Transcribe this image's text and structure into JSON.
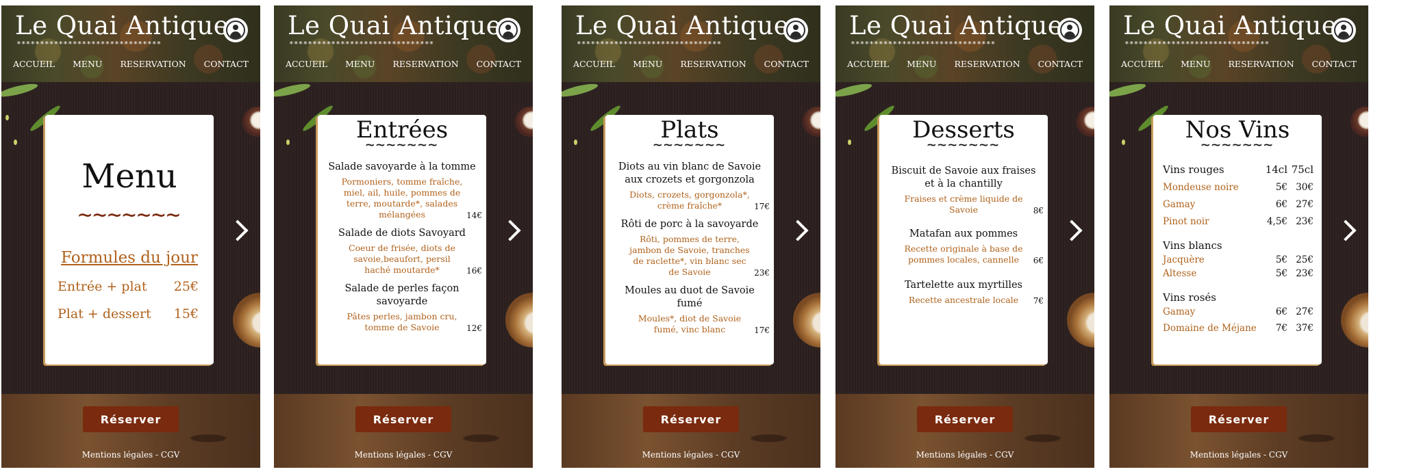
{
  "site": {
    "brand": "Le Quai Antique",
    "stars": "*******************************",
    "nav": [
      "ACCUEIL",
      "MENU",
      "RESERVATION",
      "CONTACT"
    ],
    "reserve_label": "Réserver",
    "legal": "Mentions légales - CGV"
  },
  "colors": {
    "accent": "#b0621c",
    "button": "#7a2a0e",
    "background": "#2c2120"
  },
  "icons": {
    "profile": "user-circle-icon",
    "next": "chevron-right-icon"
  },
  "screens": {
    "menu": {
      "title": "Menu",
      "wave": "~~~~~~~",
      "formules_title": "Formules du jour",
      "formules": [
        {
          "label": "Entrée + plat",
          "price": "25€"
        },
        {
          "label": "Plat + dessert",
          "price": "15€"
        }
      ]
    },
    "entrees": {
      "title": "Entrées",
      "wave": "~~~~~~~",
      "items": [
        {
          "name": "Salade savoyarde à la tomme",
          "desc": "Pormoniers, tomme fraîche, miel, ail, huile, pommes de terre, moutarde*, salades mélangées",
          "price": "14€"
        },
        {
          "name": "Salade de diots Savoyard",
          "desc": "Coeur de frisée, diots de savoie,beaufort, persil haché moutarde*",
          "price": "16€"
        },
        {
          "name": "Salade de perles façon savoyarde",
          "desc": "Pâtes perles, jambon cru, tomme de Savoie",
          "price": "12€"
        }
      ]
    },
    "plats": {
      "title": "Plats",
      "wave": "~~~~~~~",
      "items": [
        {
          "name": "Diots au vin blanc de Savoie aux crozets et gorgonzola",
          "desc": "Diots, crozets, gorgonzola*, crème fraîche*",
          "price": "17€"
        },
        {
          "name": "Rôti de porc à la savoyarde",
          "desc": "Rôti, pommes de terre, jambon de Savoie, tranches de raclette*, vin blanc sec de Savoie",
          "price": "23€"
        },
        {
          "name": "Moules au duot de Savoie fumé",
          "desc": "Moules*, diot de Savoie fumé, vinc blanc",
          "price": "17€"
        }
      ]
    },
    "desserts": {
      "title": "Desserts",
      "wave": "~~~~~~~",
      "items": [
        {
          "name": "Biscuit de Savoie aux fraises et à la chantilly",
          "desc": "Fraises et crème liquide de Savoie",
          "price": "8€"
        },
        {
          "name": "Matafan aux pommes",
          "desc": "Recette originale à base de pommes locales, cannelle",
          "price": "6€"
        },
        {
          "name": "Tartelette aux myrtilles",
          "desc": "Recette ancestrale locale",
          "price": "7€"
        }
      ]
    },
    "vins": {
      "title": "Nos Vins",
      "wave": "~~~~~~~",
      "groups": [
        {
          "heading": "Vins rouges",
          "col1": "14cl",
          "col2": "75cl",
          "wines": [
            {
              "name": "Mondeuse noire",
              "p1": "5€",
              "p2": "30€"
            },
            {
              "name": "Gamay",
              "p1": "6€",
              "p2": "27€"
            },
            {
              "name": "Pinot noir",
              "p1": "4,5€",
              "p2": "23€"
            }
          ]
        },
        {
          "heading": "Vins blancs",
          "col1": "",
          "col2": "",
          "wines": [
            {
              "name": "Jacquère",
              "p1": "5€",
              "p2": "25€"
            },
            {
              "name": "Altesse",
              "p1": "5€",
              "p2": "23€"
            }
          ]
        },
        {
          "heading": "Vins rosés",
          "col1": "",
          "col2": "",
          "wines": [
            {
              "name": "Gamay",
              "p1": "6€",
              "p2": "27€"
            },
            {
              "name": "Domaine de Méjane",
              "p1": "7€",
              "p2": "37€"
            }
          ]
        }
      ]
    }
  }
}
